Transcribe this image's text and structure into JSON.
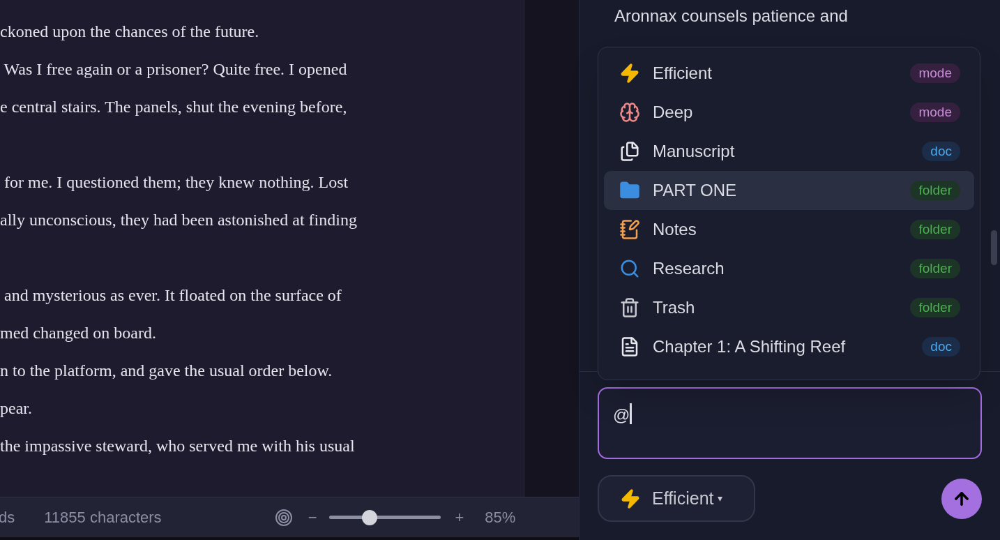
{
  "editor": {
    "blocks": [
      [
        "ckoned upon the chances of the future.",
        " Was I free again or a prisoner? Quite free. I opened",
        "e central stairs. The panels, shut the evening before,"
      ],
      [
        " for me. I questioned them; they knew nothing. Lost",
        "ally unconscious, they had been astonished at finding"
      ],
      [
        " and mysterious as ever. It floated on the surface of",
        "med changed on board.",
        "n to the platform, and gave the usual order below.",
        "pear.",
        "the impassive steward, who served me with his usual"
      ]
    ]
  },
  "status_bar": {
    "words": "ds",
    "characters": "11855 characters",
    "zoom_out": "−",
    "zoom_in": "+",
    "level": 0.36,
    "zoom": "85%"
  },
  "chat": {
    "message_lines": [
      "Aronnax counsels patience and"
    ],
    "mention_menu": [
      {
        "label": "Efficient",
        "badge": "mode",
        "kind": "mode",
        "selected": false
      },
      {
        "label": "Deep",
        "badge": "mode",
        "kind": "mode",
        "selected": false
      },
      {
        "label": "Manuscript",
        "badge": "doc",
        "kind": "doc",
        "selected": false
      },
      {
        "label": "PART ONE",
        "badge": "folder",
        "kind": "folder",
        "selected": true
      },
      {
        "label": "Notes",
        "badge": "folder",
        "kind": "folder",
        "selected": false
      },
      {
        "label": "Research",
        "badge": "folder",
        "kind": "folder",
        "selected": false
      },
      {
        "label": "Trash",
        "badge": "folder",
        "kind": "folder",
        "selected": false
      },
      {
        "label": "Chapter 1: A Shifting Reef",
        "badge": "doc",
        "kind": "doc",
        "selected": false
      }
    ],
    "input": {
      "value": "@"
    },
    "mode_button": {
      "label": "Efficient",
      "caret": "▾"
    }
  }
}
